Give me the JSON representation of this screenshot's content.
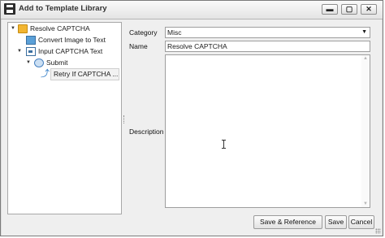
{
  "window": {
    "title": "Add to Template Library",
    "controls": {
      "minimize": "▬",
      "maximize": "▢",
      "close": "✕"
    }
  },
  "tree": {
    "nodes": [
      {
        "label": "Resolve CAPTCHA",
        "icon": "folder-icon",
        "toggle": "▼"
      },
      {
        "label": "Convert Image to Text",
        "icon": "image-icon"
      },
      {
        "label": "Input CAPTCHA Text",
        "icon": "input-field-icon",
        "toggle": "▼"
      },
      {
        "label": "Submit",
        "icon": "submit-icon",
        "toggle": "▼"
      },
      {
        "label": "Retry If CAPTCHA ...",
        "icon": "retry-arrow-icon"
      }
    ]
  },
  "form": {
    "category_label": "Category",
    "category_value": "Misc",
    "name_label": "Name",
    "name_value": "Resolve CAPTCHA",
    "description_label": "Description",
    "description_value": ""
  },
  "buttons": {
    "save_reference": "Save & Reference",
    "save": "Save",
    "cancel": "Cancel"
  },
  "colors": {
    "folder": "#f2b531",
    "accent_blue": "#2b79c6"
  }
}
